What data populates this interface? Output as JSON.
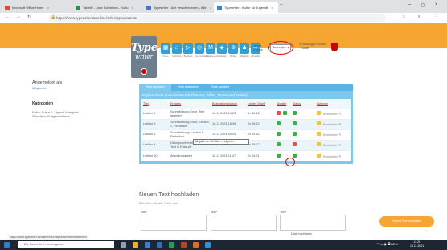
{
  "browser": {
    "tabs": [
      {
        "label": "Microsoft Office Home",
        "close": "×",
        "color": "#e34c26"
      },
      {
        "label": "Tabelle - Liste Schreiben - Kultu",
        "close": "×",
        "color": "#2e8b57"
      },
      {
        "label": "Typewriter - Alle verschiedenen - Alle",
        "close": "×",
        "color": "#4a76c9"
      },
      {
        "label": "Typewriter - Kultur für Jugendli",
        "close": "×",
        "color": "#3b82d1"
      }
    ],
    "new_tab": "+",
    "window_controls": [
      "–",
      "◻",
      "×"
    ],
    "url": "https://www.typewriter.at/online/schreibpraxis/texte",
    "back": "←",
    "forward": "→",
    "reload": "↻",
    "right_icons": [
      "☆",
      "≡",
      "⋮"
    ]
  },
  "header": {
    "logo_line1": "Type",
    "logo_line2": "writer",
    "toolbar_icons": [
      "▦",
      "⌂",
      "▷",
      "◎",
      "M",
      "◈",
      "⊕",
      "♟",
      "⇨"
    ],
    "toolbar_labels": [
      "Kurse",
      "Schreiben",
      "Begleiten",
      "Kommunikation",
      "Textgruppen",
      "Werkstatt",
      "Medien",
      "Mitglieder",
      "Abmelden"
    ],
    "user_line1": "Jenna",
    "user_line2": "Cauwe",
    "dropdown_value": "Bearbeiten ▾",
    "profile_line1": "☰  Bildungs-Portfolio",
    "profile_line2": "· Kurse"
  },
  "sidebar": {
    "heading": "Angemeldet als",
    "sub_link": "Mitglieder",
    "category_heading": "Kategorien",
    "category_text": "Kultur: Kultur & Jugend, Kategorie: Schreiben, Fortgeschrittene"
  },
  "main": {
    "tabs": [
      "Texte schreiben",
      "Texte abgegeben",
      "Texte korrigiert"
    ],
    "panel_title": "Eigene Texte (zusammen mit Themen, Bilder, Noten und Ferien)",
    "columns": [
      "Titel",
      "Ereignis",
      "Bearbeitungsdatum",
      "Letzter Zugriff",
      "Abgabe",
      "Status",
      "Aktionen"
    ],
    "rows": [
      {
        "title": "Lektion 8",
        "event": "Schreibübung Ende, Text abgeben",
        "edited": "14.11.2021 14:23",
        "access": "2x 16:12",
        "status_color": "#e05050"
      },
      {
        "title": "Lektion 9",
        "event": "Schreibübung Ende, Lektion 2, Feedback",
        "edited": "18.11.2021 16:49",
        "access": "2x 16:12",
        "status_color": "#f2c23e"
      },
      {
        "title": "Lektion 5",
        "event": "Schreibübung: Lektion 5, Redaktion",
        "edited": "15.11.2021 09:25",
        "access": "2x 12:52",
        "status_color": "#3fae4a"
      },
      {
        "title": "Lektion 4",
        "event": "Übungsvorbereitung Ende, Text in Entwurf",
        "edited": "14.11.2021 10:04",
        "access": "2x 18:12",
        "status_color": "#55a7dd"
      },
      {
        "title": "Lektion 10",
        "event": "Abschlussarbeit",
        "edited": "15.11.2021 11:47",
        "access": "2x 14:21",
        "status_color": "#3fae4a"
      }
    ],
    "edit_label": "Bearbeiten ✎",
    "tooltip": "Abgabe an Schülern freigeben"
  },
  "new_text": {
    "title": "Neuen Text hochladen",
    "subtitle": "Bitte füllen Sie alle Felder aus.",
    "labels": [
      "Titel*",
      "Text*",
      "Text*"
    ],
    "submit_label": "Neuen Text hochladen",
    "hint": "Datei hochladen"
  },
  "status_bar": "https://www.typewriter.at/online/schreibpraxis/texte/bearbeiten",
  "taskbar": {
    "search_placeholder": "Zur Suche Text hier eingeben",
    "time": "13:25",
    "date": "19.11.2021",
    "tray": "⌃ ▭ ◉ 𝄚 DEU"
  }
}
